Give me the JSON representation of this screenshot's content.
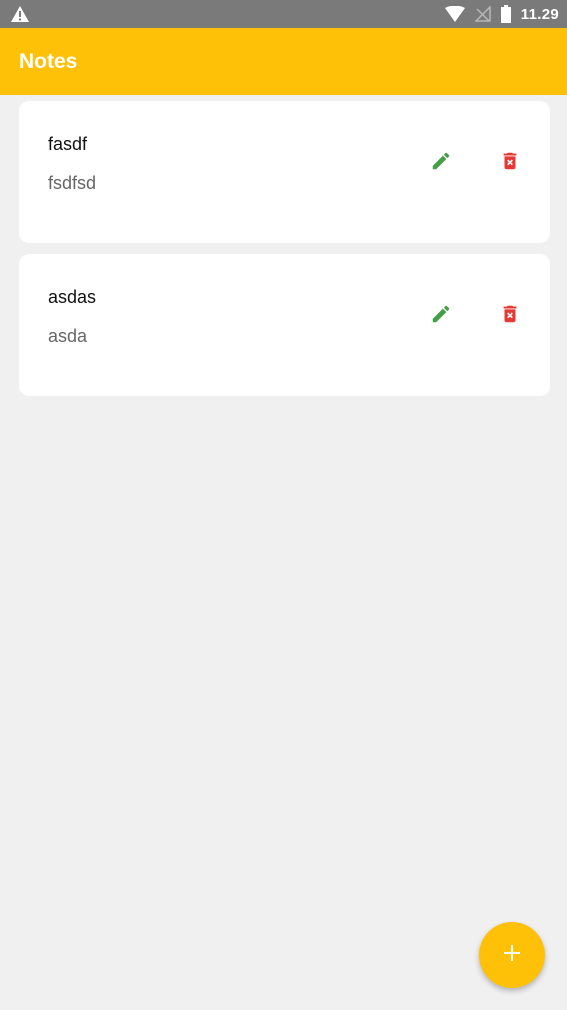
{
  "status_bar": {
    "time": "11.29",
    "icons": [
      "warning-icon",
      "wifi-icon",
      "no-sim-icon",
      "battery-icon"
    ]
  },
  "app_bar": {
    "title": "Notes",
    "color": "#ffc107"
  },
  "notes": [
    {
      "title": "fasdf",
      "body": "fsdfsd"
    },
    {
      "title": "asdas",
      "body": "asda"
    }
  ],
  "actions": {
    "edit_icon": "pencil-icon",
    "delete_icon": "trash-icon",
    "edit_color": "#43a047",
    "delete_color": "#e53935",
    "fab_icon": "plus-icon"
  }
}
